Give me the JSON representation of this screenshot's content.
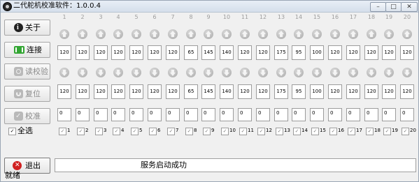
{
  "window": {
    "title": "二代舵机校准软件：1.0.0.4"
  },
  "sidebar": {
    "about": "关于",
    "connect": "连接",
    "read": "读校验",
    "reset": "复位",
    "calibrate": "校准",
    "select_all": "全选",
    "exit": "退出"
  },
  "channels": [
    "1",
    "2",
    "3",
    "4",
    "5",
    "6",
    "7",
    "8",
    "9",
    "10",
    "11",
    "12",
    "13",
    "14",
    "15",
    "16",
    "17",
    "18",
    "19",
    "20"
  ],
  "values_row1": [
    "120",
    "120",
    "120",
    "120",
    "120",
    "120",
    "120",
    "65",
    "145",
    "140",
    "120",
    "120",
    "175",
    "95",
    "100",
    "120",
    "120",
    "120",
    "120",
    "120"
  ],
  "values_row2": [
    "120",
    "120",
    "120",
    "120",
    "120",
    "120",
    "120",
    "65",
    "145",
    "140",
    "120",
    "120",
    "175",
    "95",
    "100",
    "120",
    "120",
    "120",
    "120",
    "120"
  ],
  "values_row3": [
    "0",
    "0",
    "0",
    "0",
    "0",
    "0",
    "0",
    "0",
    "0",
    "0",
    "0",
    "0",
    "0",
    "0",
    "0",
    "0",
    "0",
    "0",
    "0",
    "0"
  ],
  "checkboxes": {
    "checked": true,
    "mark": "✓"
  },
  "status_message": "服务启动成功",
  "footer_status": "就绪",
  "icons": {
    "about": "info-icon",
    "connect": "connect-icon",
    "read": "read-icon",
    "reset": "reset-icon",
    "calibrate": "calibrate-icon",
    "exit": "exit-icon"
  }
}
